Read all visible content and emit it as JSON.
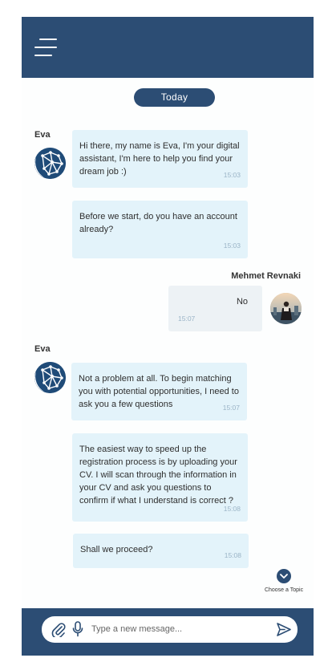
{
  "header": {
    "menu_icon": "hamburger-menu-icon",
    "color": "#2c4d74"
  },
  "date_label": "Today",
  "messages": [
    {
      "sender": "Eva",
      "text": "Hi there, my name is Eva, I'm your digital assistant, I'm here to help you find your dream job :)",
      "time": "15:03"
    },
    {
      "sender": "Eva",
      "text": "Before we start, do you have an account already?",
      "time": "15:03"
    },
    {
      "sender": "Mehmet Revnaki",
      "text": "No",
      "time": "15:07"
    },
    {
      "sender": "Eva",
      "text": "Not a problem at all. To begin matching you with potential opportunities, I need to ask you a few questions",
      "time": "15:07"
    },
    {
      "sender": "Eva",
      "text": "The easiest way to speed up the registration process is by uploading your CV. I will scan through the information in your CV and ask you questions to confirm if what I understand is correct ?",
      "time": "15:08"
    },
    {
      "sender": "Eva",
      "text": "Shall we proceed?",
      "time": "15:08"
    }
  ],
  "sender_labels": {
    "bot": "Eva",
    "user": "Mehmet Revnaki"
  },
  "topic": {
    "label": "Choose a Topic",
    "icon": "chevron-down-icon"
  },
  "composer": {
    "placeholder": "Type a new message...",
    "attach_icon": "paperclip-icon",
    "mic_icon": "microphone-icon",
    "send_icon": "send-icon"
  },
  "colors": {
    "primary": "#2c4d74",
    "bot_bubble": "#e3f3fa",
    "user_bubble": "#edf2f5",
    "time": "#9bb4c7"
  }
}
